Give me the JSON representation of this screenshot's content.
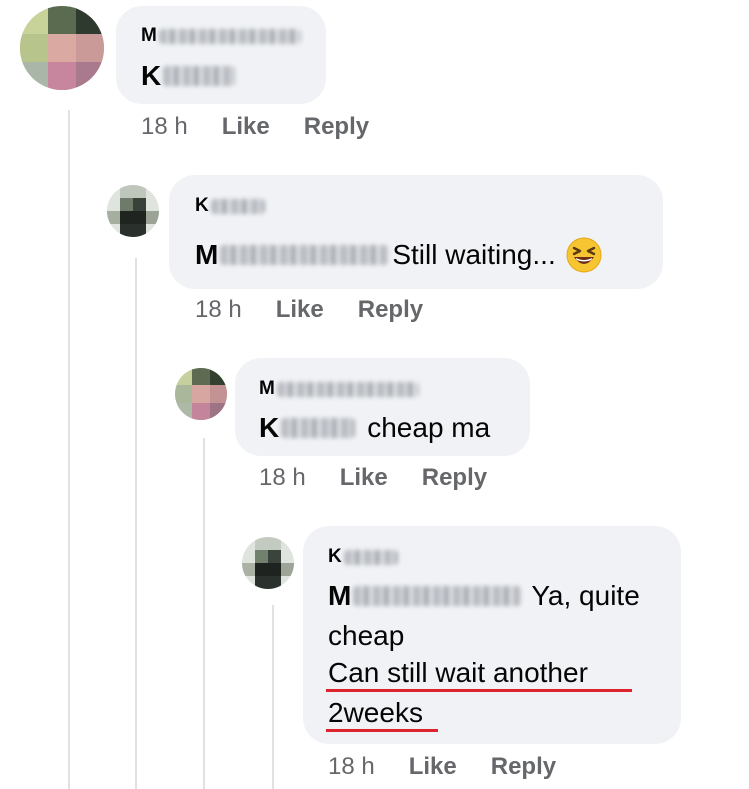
{
  "comments": [
    {
      "author_initial": "M",
      "body_prefix_initial": "K",
      "body_text": "",
      "meta": {
        "time": "18 h",
        "like": "Like",
        "reply": "Reply"
      }
    },
    {
      "author_initial": "K",
      "body_prefix_initial": "M",
      "body_text": "Still waiting...",
      "emoji": "grinning-squinting-face-icon",
      "meta": {
        "time": "18 h",
        "like": "Like",
        "reply": "Reply"
      }
    },
    {
      "author_initial": "M",
      "body_prefix_initial": "K",
      "body_text": "cheap ma",
      "meta": {
        "time": "18 h",
        "like": "Like",
        "reply": "Reply"
      }
    },
    {
      "author_initial": "K",
      "body_prefix_initial": "M",
      "body_text": "Ya, quite",
      "body_line2": "cheap",
      "underlined_line1": "Can still wait another",
      "underlined_line2": "2weeks",
      "meta": {
        "time": "18 h",
        "like": "Like",
        "reply": "Reply"
      }
    }
  ],
  "colors": {
    "bubble": "#f0f2f5",
    "meta_text": "#65676b",
    "thread_line": "#dfe1e5",
    "annotation_underline": "#e0242f"
  }
}
